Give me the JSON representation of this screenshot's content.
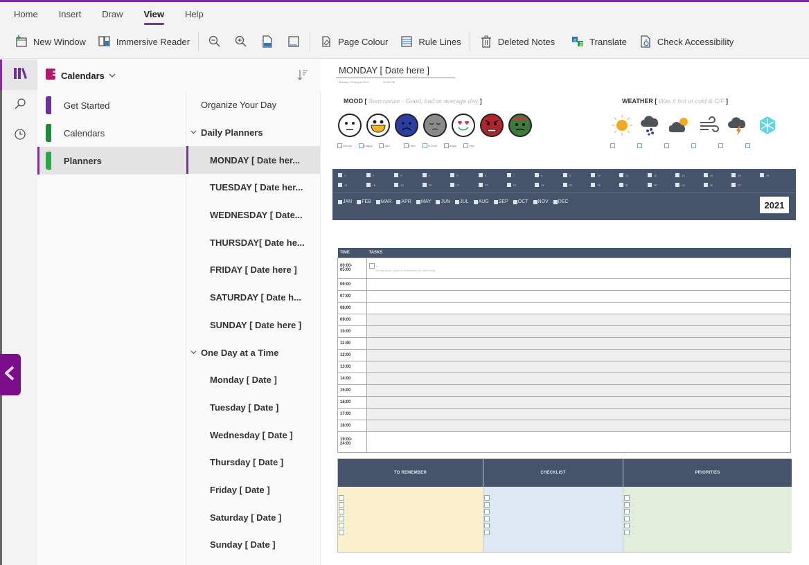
{
  "ribbon": {
    "menu_tabs": [
      "Home",
      "Insert",
      "Draw",
      "View",
      "Help"
    ],
    "active_tab": "View",
    "toolbar": {
      "new_window": "New Window",
      "immersive_reader": "Immersive Reader",
      "zoom_out": "zoom-out",
      "zoom_in": "zoom-in",
      "page_width": "page-width",
      "full_page": "full-page-view",
      "page_colour": "Page Colour",
      "rule_lines": "Rule Lines",
      "deleted_notes": "Deleted Notes",
      "translate": "Translate",
      "check_accessibility": "Check Accessibility"
    }
  },
  "rail": {
    "items": [
      "notebooks-icon",
      "search-icon",
      "recent-icon"
    ]
  },
  "notebook": {
    "name": "Calendars",
    "color": "#b4176f"
  },
  "sections": [
    {
      "label": "Get Started",
      "color": "#6b2fa0"
    },
    {
      "label": "Calendars",
      "color": "#1f8a3c"
    },
    {
      "label": "Planners",
      "color": "#26a748",
      "active": true
    }
  ],
  "pages": [
    {
      "label": "Organize Your Day",
      "kind": "level0"
    },
    {
      "label": "Daily Planners",
      "kind": "group"
    },
    {
      "label": "MONDAY [ Date her...",
      "kind": "level1",
      "active": true
    },
    {
      "label": "TUESDAY [ Date her...",
      "kind": "level1"
    },
    {
      "label": "WEDNESDAY [ Date...",
      "kind": "level1"
    },
    {
      "label": "THURSDAY[ Date he...",
      "kind": "level1"
    },
    {
      "label": "FRIDAY [ Date here ]",
      "kind": "level1"
    },
    {
      "label": "SATURDAY [ Date h...",
      "kind": "level1"
    },
    {
      "label": "SUNDAY [ Date here ]",
      "kind": "level1"
    },
    {
      "label": "One Day at a Time",
      "kind": "group"
    },
    {
      "label": "Monday [ Date ]",
      "kind": "level1"
    },
    {
      "label": "Tuesday [ Date ]",
      "kind": "level1"
    },
    {
      "label": "Wednesday [ Date ]",
      "kind": "level1"
    },
    {
      "label": "Thursday [ Date ]",
      "kind": "level1"
    },
    {
      "label": "Friday [ Date ]",
      "kind": "level1"
    },
    {
      "label": "Saturday [ Date ]",
      "kind": "level1"
    },
    {
      "label": "Sunday [ Date ]",
      "kind": "level1"
    }
  ],
  "page": {
    "title": "MONDAY [ Date here ]",
    "date": "Monday, 23 August 2021",
    "time": "12:45 PM",
    "mood": {
      "label": "MOOD [",
      "hint": " Summarize - Good, bad or average day ",
      "close": "]",
      "options": [
        "Normal",
        "Happy",
        "Sad",
        "Tired",
        "In Love",
        "Angry",
        "Sick"
      ]
    },
    "weather": {
      "label": "WEATHER [",
      "hint": " Was it hot or cold & C/F ",
      "close": "]",
      "options": [
        "sunny",
        "hail",
        "partly-cloudy",
        "windy",
        "thunderstorm",
        "snow"
      ]
    },
    "days_row1": [
      "1",
      "2",
      "3",
      "4",
      "5",
      "6",
      "7",
      "8",
      "9",
      "10",
      "11",
      "12",
      "13",
      "14",
      "15",
      "16"
    ],
    "days_row2": [
      "17",
      "18",
      "19",
      "20",
      "21",
      "22",
      "23",
      "24",
      "25",
      "26",
      "27",
      "28",
      "29",
      "30",
      "31"
    ],
    "months": [
      "JAN",
      "FEB",
      "MAR",
      "APR",
      "MAY",
      "JUN",
      "JUL",
      "AUG",
      "SEP",
      "OCT",
      "NOV",
      "DEC"
    ],
    "year": "2021",
    "schedule": {
      "headers": [
        "TIME",
        "TASKS"
      ],
      "task_hint": "List any tasks, plans or schedules you have today",
      "first_task_bullet": "...",
      "rows": [
        {
          "time": "00:00-\n05:00",
          "kind": "first"
        },
        {
          "time": "06:00",
          "kind": "plain"
        },
        {
          "time": "07:00",
          "kind": "plain"
        },
        {
          "time": "08:00",
          "kind": "plain"
        },
        {
          "time": "09:00",
          "kind": "shade"
        },
        {
          "time": "10:00",
          "kind": "shade"
        },
        {
          "time": "11:00",
          "kind": "shade"
        },
        {
          "time": "12:00",
          "kind": "shade"
        },
        {
          "time": "13:00",
          "kind": "shade"
        },
        {
          "time": "14:00",
          "kind": "shade"
        },
        {
          "time": "15:00",
          "kind": "shade"
        },
        {
          "time": "16:00",
          "kind": "shade"
        },
        {
          "time": "17:00",
          "kind": "shade"
        },
        {
          "time": "18:00",
          "kind": "shade"
        },
        {
          "time": "19:00-\n24:00",
          "kind": "tall"
        }
      ]
    },
    "boxes": [
      {
        "title": "TO REMEMBER",
        "bg": "#fdf0cc",
        "items": [
          "...",
          "...",
          "...",
          "...",
          "...",
          "..."
        ]
      },
      {
        "title": "CHECKLIST",
        "bg": "#dfe9f6",
        "items": [
          "...",
          "...",
          "...",
          "...",
          "...",
          "..."
        ]
      },
      {
        "title": "PRIORITIES",
        "bg": "#e1eed9",
        "items": [
          "...",
          "...",
          "...",
          "...",
          "...",
          "..."
        ]
      }
    ]
  },
  "colors": {
    "accent": "#7b2fa6",
    "banner": "#45546a",
    "collapse_button": "#7a0d8a"
  }
}
